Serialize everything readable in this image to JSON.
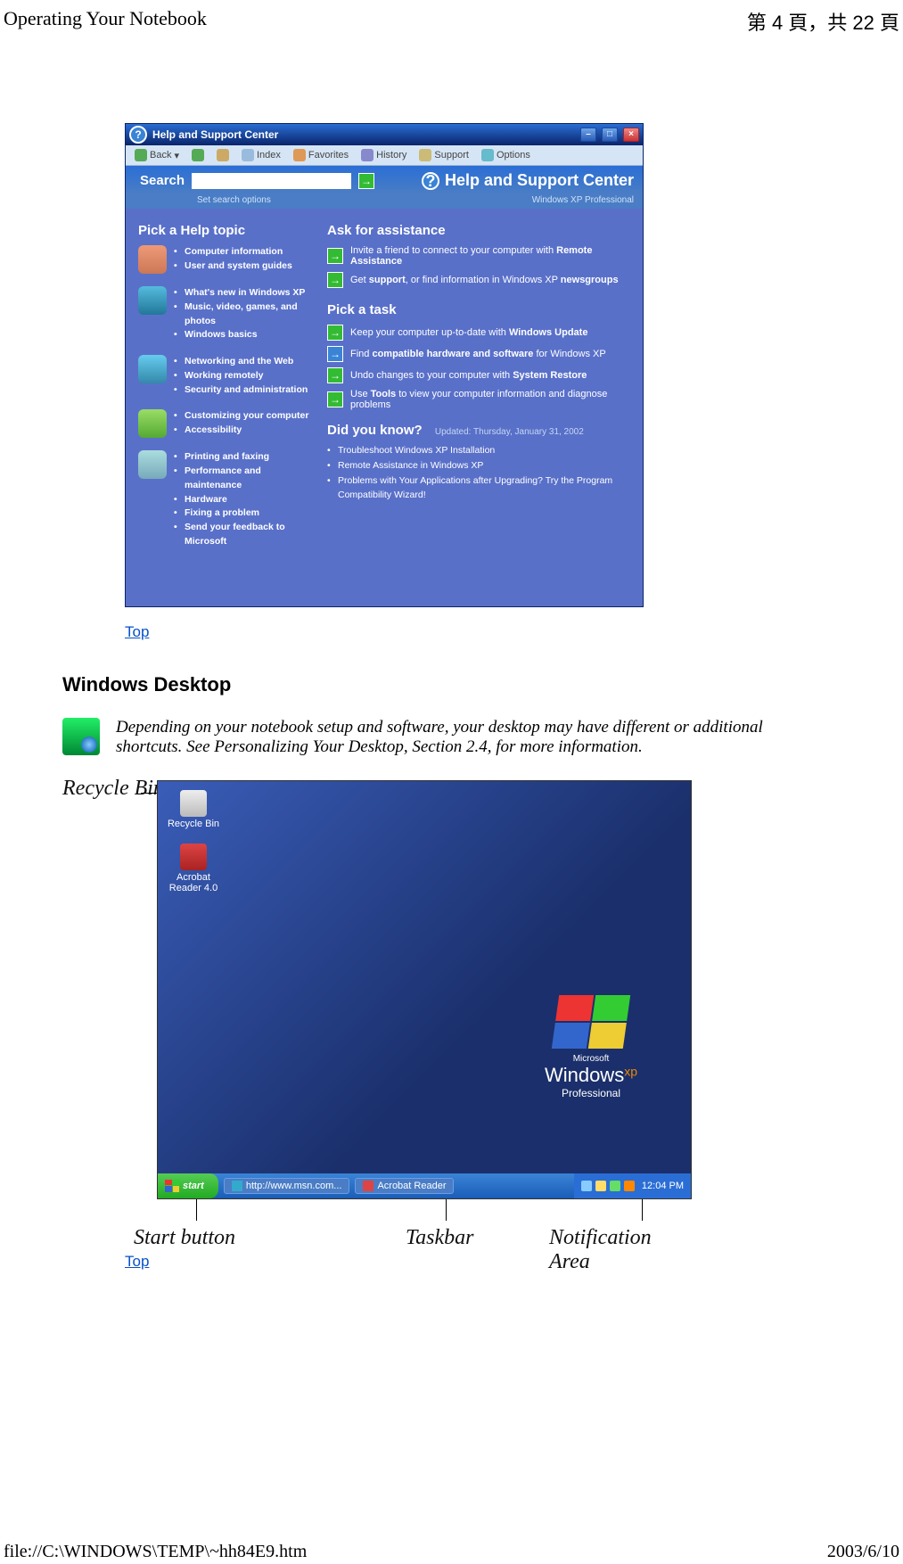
{
  "header": {
    "left": "Operating Your Notebook",
    "right": "第 4 頁，共 22 頁"
  },
  "footer": {
    "left": "file://C:\\WINDOWS\\TEMP\\~hh84E9.htm",
    "right": "2003/6/10"
  },
  "hsc": {
    "title": "Help and Support Center",
    "toolbar": {
      "back": "Back",
      "index": "Index",
      "favorites": "Favorites",
      "history": "History",
      "support": "Support",
      "options": "Options"
    },
    "search_label": "Search",
    "set_search": "Set search options",
    "center_title": "Help and Support Center",
    "edition": "Windows XP Professional",
    "pick_topic": "Pick a Help topic",
    "topics": {
      "g1": [
        "Computer information",
        "User and system guides"
      ],
      "g2": [
        "What's new in Windows XP",
        "Music, video, games, and photos",
        "Windows basics"
      ],
      "g3": [
        "Networking and the Web",
        "Working remotely",
        "Security and administration"
      ],
      "g4": [
        "Customizing your computer",
        "Accessibility"
      ],
      "g5": [
        "Printing and faxing",
        "Performance and maintenance",
        "Hardware",
        "Fixing a problem",
        "Send your feedback to Microsoft"
      ]
    },
    "ask": {
      "title": "Ask for assistance",
      "r1a": "Invite a friend to connect to your computer with ",
      "r1b": "Remote Assistance",
      "r2a": "Get ",
      "r2b": "support",
      "r2c": ", or find information in Windows XP ",
      "r2d": "newsgroups"
    },
    "task": {
      "title": "Pick a task",
      "r1a": "Keep your computer up-to-date with ",
      "r1b": "Windows Update",
      "r2a": "Find ",
      "r2b": "compatible hardware and software",
      "r2c": " for Windows XP",
      "r3a": "Undo changes to your computer with ",
      "r3b": "System Restore",
      "r4a": "Use ",
      "r4b": "Tools",
      "r4c": " to view your computer information and diagnose problems"
    },
    "dyk": {
      "title": "Did you know?",
      "updated": "Updated: Thursday, January 31, 2002",
      "items": [
        "Troubleshoot Windows XP Installation",
        "Remote Assistance in Windows XP",
        "Problems with Your Applications after Upgrading? Try the Program Compatibility Wizard!"
      ]
    }
  },
  "top_link": "Top",
  "section_title": "Windows Desktop",
  "notice_text": "Depending on your notebook setup and software, your desktop may have different or additional shortcuts. See Personalizing Your Desktop, Section 2.4, for more information.",
  "desktop": {
    "annot_recycle": "Recycle Bin",
    "annot_start": "Start button",
    "annot_taskbar": "Taskbar",
    "annot_notif": "Notification Area",
    "icon_recycle": "Recycle Bin",
    "icon_acrobat": "Acrobat Reader 4.0",
    "win_brand_pre": "Microsoft",
    "win_brand": "Windows",
    "win_brand_suf": "xp",
    "win_pro": "Professional",
    "start": "start",
    "task_ie": "http://www.msn.com...",
    "task_ar": "Acrobat Reader",
    "clock": "12:04 PM"
  }
}
